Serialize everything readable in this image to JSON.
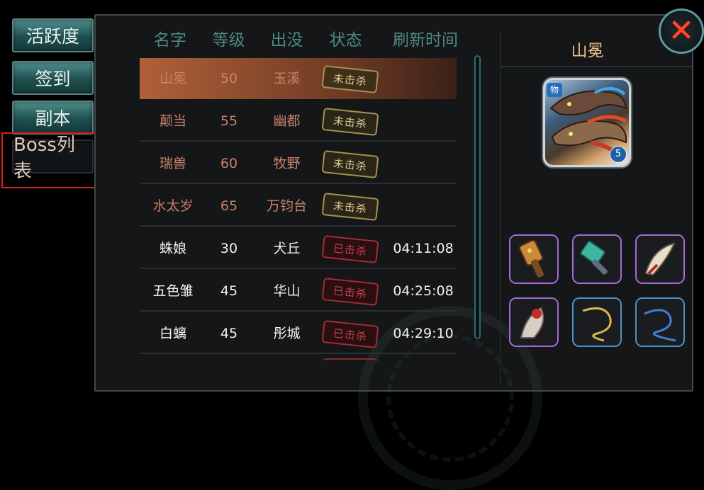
{
  "sidebar": {
    "tabs": [
      {
        "label": "活跃度",
        "active": false
      },
      {
        "label": "签到",
        "active": false
      },
      {
        "label": "副本",
        "active": false
      },
      {
        "label": "Boss列表",
        "active": true
      }
    ]
  },
  "table": {
    "headers": [
      "名字",
      "等级",
      "出没",
      "状态",
      "刷新时间"
    ],
    "rows": [
      {
        "name": "山冕",
        "level": "50",
        "location": "玉溪",
        "status": "未击杀",
        "refresh": ""
      },
      {
        "name": "颠当",
        "level": "55",
        "location": "幽都",
        "status": "未击杀",
        "refresh": ""
      },
      {
        "name": "瑞兽",
        "level": "60",
        "location": "牧野",
        "status": "未击杀",
        "refresh": ""
      },
      {
        "name": "水太岁",
        "level": "65",
        "location": "万钧台",
        "status": "未击杀",
        "refresh": ""
      },
      {
        "name": "蛛娘",
        "level": "30",
        "location": "犬丘",
        "status": "已击杀",
        "refresh": "04:11:08"
      },
      {
        "name": "五色雏",
        "level": "45",
        "location": "华山",
        "status": "已击杀",
        "refresh": "04:25:08"
      },
      {
        "name": "白螭",
        "level": "45",
        "location": "彤城",
        "status": "已击杀",
        "refresh": "04:29:10"
      }
    ],
    "selected_index": 0
  },
  "detail": {
    "boss_name": "山冕",
    "portrait_tag": "物",
    "portrait_count": "5",
    "drops": [
      {
        "icon": "spiked-mace-icon",
        "rarity": "purple"
      },
      {
        "icon": "jade-hammer-icon",
        "rarity": "purple"
      },
      {
        "icon": "feather-blade-icon",
        "rarity": "purple"
      },
      {
        "icon": "demon-mask-fan-icon",
        "rarity": "purple"
      },
      {
        "icon": "golden-whip-icon",
        "rarity": "blue"
      },
      {
        "icon": "blue-whip-icon",
        "rarity": "blue"
      }
    ]
  },
  "colors": {
    "header_text": "#4d8a7e",
    "selected_row": "#b06138",
    "boss_title": "#e9bf87",
    "alive_stamp": "#ddcc8c",
    "killed_stamp": "#c9424a",
    "purple_rarity": "#a56ad6",
    "blue_rarity": "#4f8fc8"
  }
}
